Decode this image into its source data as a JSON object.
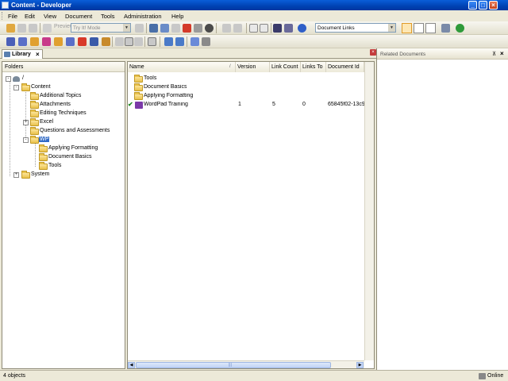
{
  "window": {
    "title": "Content - Developer",
    "controls": {
      "minimize": "_",
      "maximize": "□",
      "close": "×"
    }
  },
  "menu": [
    "File",
    "Edit",
    "View",
    "Document",
    "Tools",
    "Administration",
    "Help"
  ],
  "toolbar": {
    "preview_label": "Preview",
    "mode_combo": "Try It! Mode",
    "links_combo": "Document Links"
  },
  "library_tab": {
    "label": "Library",
    "close": "×"
  },
  "folders_panel": {
    "header": "Folders",
    "tree": [
      {
        "label": "/",
        "level": 0,
        "expander": "-"
      },
      {
        "label": "Content",
        "level": 1,
        "expander": "-"
      },
      {
        "label": "Additional Topics",
        "level": 2,
        "expander": ""
      },
      {
        "label": "Attachments",
        "level": 2,
        "expander": ""
      },
      {
        "label": "Editing Techniques",
        "level": 2,
        "expander": ""
      },
      {
        "label": "Excel",
        "level": 2,
        "expander": "+"
      },
      {
        "label": "Questions and Assessments",
        "level": 2,
        "expander": ""
      },
      {
        "label": "WP",
        "level": 2,
        "expander": "-",
        "selected": true
      },
      {
        "label": "Applying Formatting",
        "level": 3,
        "expander": ""
      },
      {
        "label": "Document Basics",
        "level": 3,
        "expander": ""
      },
      {
        "label": "Tools",
        "level": 3,
        "expander": ""
      },
      {
        "label": "System",
        "level": 1,
        "expander": "+"
      }
    ]
  },
  "documents_panel": {
    "columns": {
      "name": "Name",
      "sort": "/",
      "version": "Version",
      "link_count": "Link Count",
      "links_to": "Links To",
      "document_id": "Document Id"
    },
    "rows": [
      {
        "name": "Tools",
        "type": "folder",
        "version": "",
        "link_count": "",
        "links_to": "",
        "document_id": ""
      },
      {
        "name": "Document Basics",
        "type": "folder",
        "version": "",
        "link_count": "",
        "links_to": "",
        "document_id": ""
      },
      {
        "name": "Applying Formatting",
        "type": "folder",
        "version": "",
        "link_count": "",
        "links_to": "",
        "document_id": ""
      },
      {
        "name": "WordPad Training",
        "type": "document",
        "checked": "✔",
        "version": "1",
        "link_count": "5",
        "links_to": "0",
        "document_id": "65845f02-13c9-"
      }
    ],
    "hscroll_mark": "|||"
  },
  "related_panel": {
    "title": "Related Documents",
    "pin": "⊼",
    "close": "×"
  },
  "status": {
    "left": "4 objects",
    "right": "Online"
  },
  "colors": {
    "title_bar": "#0054e3",
    "selection": "#316ac5",
    "chrome": "#ece9d8",
    "check": "#1f8a1f"
  }
}
